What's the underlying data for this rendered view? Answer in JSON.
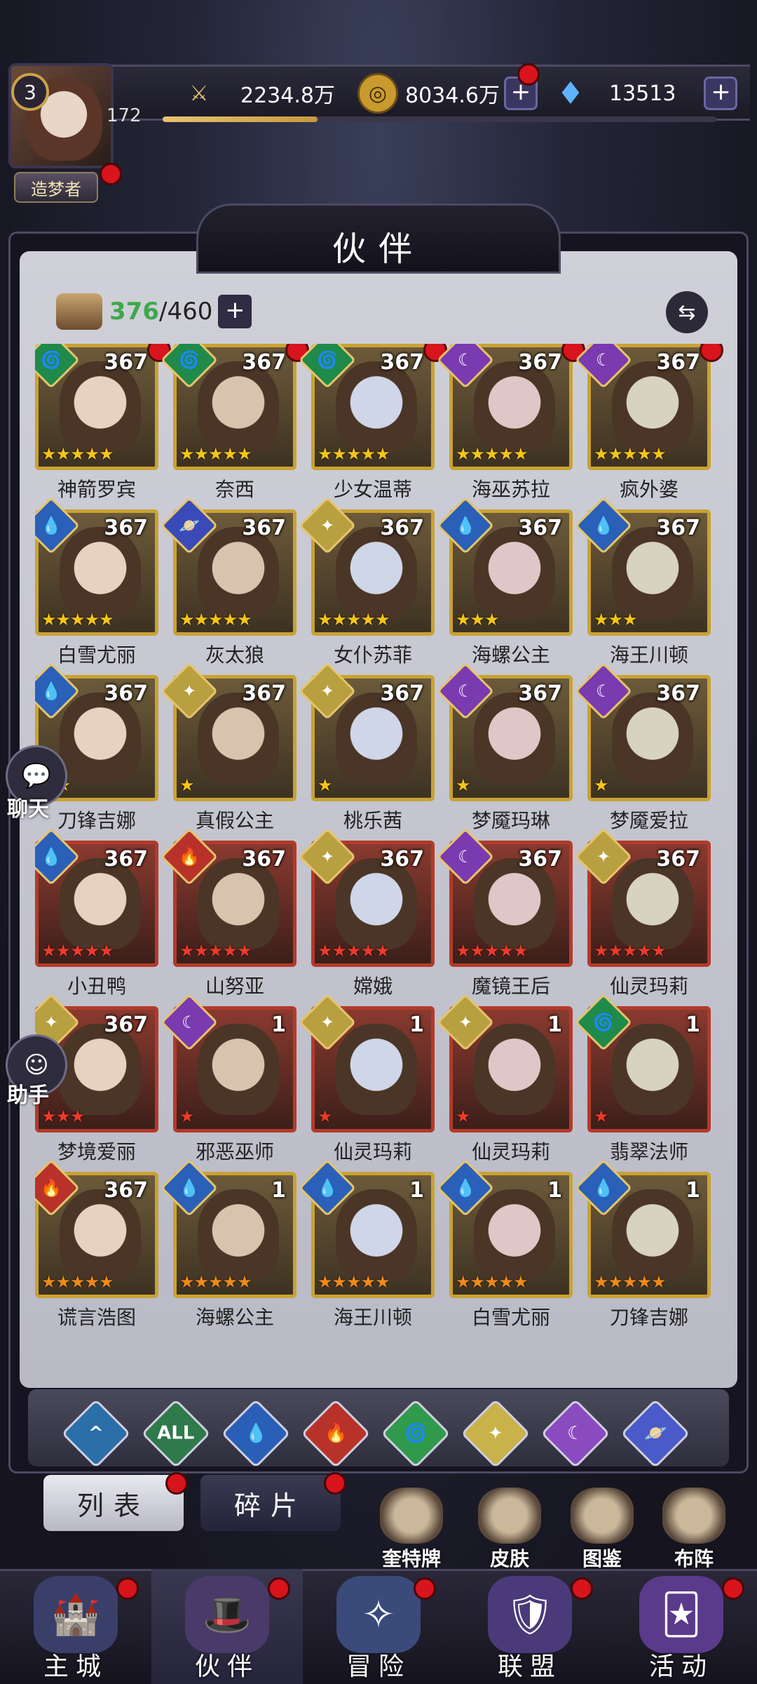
{
  "header": {
    "player_level": "3",
    "player_id_level": "172",
    "exp_progress": 0.28,
    "title_badge": "造梦者",
    "power": "2234.8万",
    "gold": "8034.6万",
    "diamonds": "13513",
    "plus_label": "+"
  },
  "panel": {
    "title": "伙伴",
    "count_current": "376",
    "count_max": "/460",
    "swap_icon": "⇆"
  },
  "companions": [
    {
      "name": "神箭罗宾",
      "level": "367",
      "element": "wind",
      "stars": 5,
      "star_color": "gold",
      "frame": "gold",
      "dot": true
    },
    {
      "name": "奈西",
      "level": "367",
      "element": "wind",
      "stars": 5,
      "star_color": "gold",
      "frame": "gold",
      "dot": true
    },
    {
      "name": "少女温蒂",
      "level": "367",
      "element": "wind",
      "stars": 5,
      "star_color": "gold",
      "frame": "gold",
      "dot": true
    },
    {
      "name": "海巫苏拉",
      "level": "367",
      "element": "moon",
      "stars": 5,
      "star_color": "gold",
      "frame": "gold",
      "dot": true
    },
    {
      "name": "疯外婆",
      "level": "367",
      "element": "moon",
      "stars": 5,
      "star_color": "gold",
      "frame": "gold",
      "dot": true
    },
    {
      "name": "白雪尤丽",
      "level": "367",
      "element": "water",
      "stars": 5,
      "star_color": "gold",
      "frame": "gold",
      "dot": false
    },
    {
      "name": "灰太狼",
      "level": "367",
      "element": "planet",
      "stars": 5,
      "star_color": "gold",
      "frame": "gold",
      "dot": false
    },
    {
      "name": "女仆苏菲",
      "level": "367",
      "element": "light",
      "stars": 5,
      "star_color": "gold",
      "frame": "gold",
      "dot": false
    },
    {
      "name": "海螺公主",
      "level": "367",
      "element": "water",
      "stars": 3,
      "star_color": "gold",
      "frame": "gold",
      "dot": false
    },
    {
      "name": "海王川顿",
      "level": "367",
      "element": "water",
      "stars": 3,
      "star_color": "gold",
      "frame": "gold",
      "dot": false
    },
    {
      "name": "刀锋吉娜",
      "level": "367",
      "element": "water",
      "stars": 2,
      "star_color": "gold",
      "frame": "gold",
      "dot": false
    },
    {
      "name": "真假公主",
      "level": "367",
      "element": "light",
      "stars": 1,
      "star_color": "gold",
      "frame": "gold",
      "dot": false
    },
    {
      "name": "桃乐茜",
      "level": "367",
      "element": "light",
      "stars": 1,
      "star_color": "gold",
      "frame": "gold",
      "dot": false
    },
    {
      "name": "梦魇玛琳",
      "level": "367",
      "element": "moon",
      "stars": 1,
      "star_color": "gold",
      "frame": "gold",
      "dot": false
    },
    {
      "name": "梦魇爱拉",
      "level": "367",
      "element": "moon",
      "stars": 1,
      "star_color": "gold",
      "frame": "gold",
      "dot": false
    },
    {
      "name": "小丑鸭",
      "level": "367",
      "element": "water",
      "stars": 5,
      "star_color": "red",
      "frame": "red",
      "dot": false
    },
    {
      "name": "山努亚",
      "level": "367",
      "element": "fire",
      "stars": 5,
      "star_color": "red",
      "frame": "red",
      "dot": false
    },
    {
      "name": "嫦娥",
      "level": "367",
      "element": "light",
      "stars": 5,
      "star_color": "red",
      "frame": "red",
      "dot": false
    },
    {
      "name": "魔镜王后",
      "level": "367",
      "element": "moon",
      "stars": 5,
      "star_color": "red",
      "frame": "red",
      "dot": false
    },
    {
      "name": "仙灵玛莉",
      "level": "367",
      "element": "light",
      "stars": 5,
      "star_color": "red",
      "frame": "red",
      "dot": false
    },
    {
      "name": "梦境爱丽",
      "level": "367",
      "element": "light",
      "stars": 3,
      "star_color": "red",
      "frame": "red",
      "dot": false
    },
    {
      "name": "邪恶巫师",
      "level": "1",
      "element": "moon",
      "stars": 1,
      "star_color": "red",
      "frame": "red",
      "dot": false
    },
    {
      "name": "仙灵玛莉",
      "level": "1",
      "element": "light",
      "stars": 1,
      "star_color": "red",
      "frame": "red",
      "dot": false
    },
    {
      "name": "仙灵玛莉",
      "level": "1",
      "element": "light",
      "stars": 1,
      "star_color": "red",
      "frame": "red",
      "dot": false
    },
    {
      "name": "翡翠法师",
      "level": "1",
      "element": "wind",
      "stars": 1,
      "star_color": "red",
      "frame": "red",
      "dot": false
    },
    {
      "name": "谎言浩图",
      "level": "367",
      "element": "fire",
      "stars": 5,
      "star_color": "orange",
      "frame": "gold",
      "dot": false
    },
    {
      "name": "海螺公主",
      "level": "1",
      "element": "water",
      "stars": 5,
      "star_color": "orange",
      "frame": "gold",
      "dot": false
    },
    {
      "name": "海王川顿",
      "level": "1",
      "element": "water",
      "stars": 5,
      "star_color": "orange",
      "frame": "gold",
      "dot": false
    },
    {
      "name": "白雪尤丽",
      "level": "1",
      "element": "water",
      "stars": 5,
      "star_color": "orange",
      "frame": "gold",
      "dot": false
    },
    {
      "name": "刀锋吉娜",
      "level": "1",
      "element": "water",
      "stars": 5,
      "star_color": "orange",
      "frame": "gold",
      "dot": false
    }
  ],
  "floating": {
    "chat_label": "聊天",
    "helper_label": "助手"
  },
  "filters": [
    {
      "icon": "^",
      "color": "#2a6fa8"
    },
    {
      "icon": "ALL",
      "color": "#2e7a4a"
    },
    {
      "icon": "💧",
      "color": "#2a5fb8"
    },
    {
      "icon": "🔥",
      "color": "#b8322a"
    },
    {
      "icon": "🌀",
      "color": "#2f9a4c"
    },
    {
      "icon": "✦",
      "color": "#c9b24a"
    },
    {
      "icon": "☾",
      "color": "#8a4ac0"
    },
    {
      "icon": "🪐",
      "color": "#4a5ac8"
    }
  ],
  "tabs": {
    "list": "列表",
    "fragments": "碎片"
  },
  "tools": {
    "cards": "奎特牌",
    "skins": "皮肤",
    "codex": "图鉴",
    "formation": "布阵"
  },
  "nav": {
    "city": "主城",
    "companions": "伙伴",
    "adventure": "冒险",
    "alliance": "联盟",
    "events": "活动"
  },
  "element_colors": {
    "wind": "#1f8a4a",
    "moon": "#7a3ab0",
    "water": "#2a60b8",
    "planet": "#3a4ab8",
    "light": "#b8a040",
    "fire": "#b8322a"
  }
}
